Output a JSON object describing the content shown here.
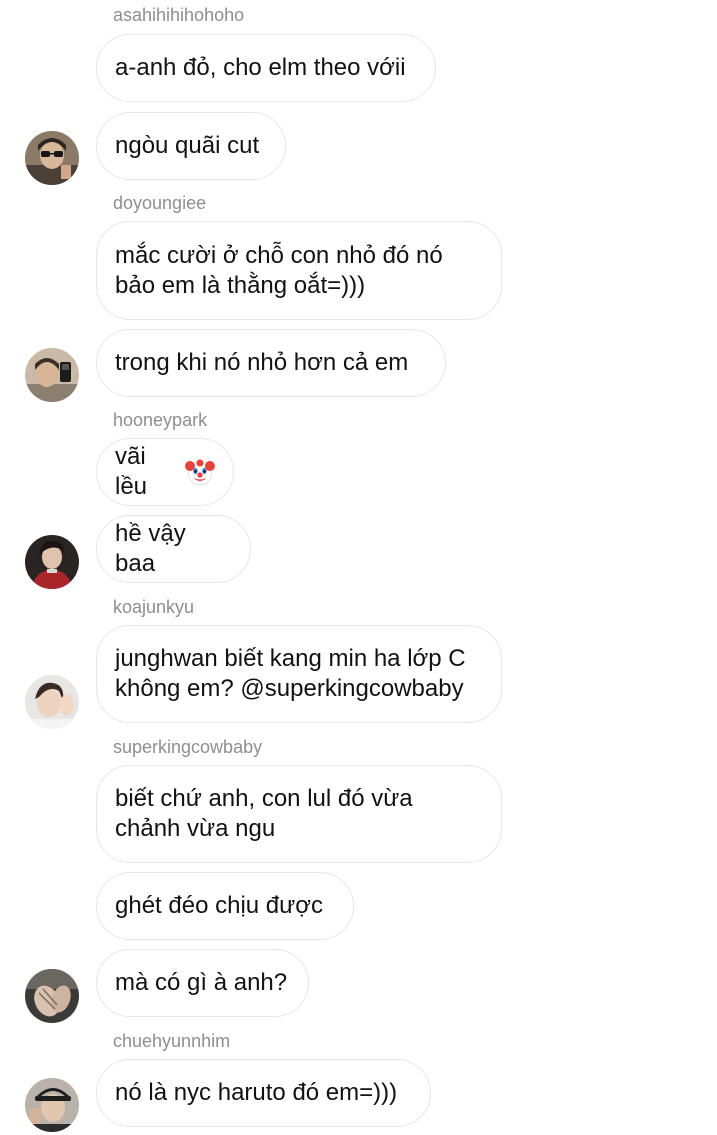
{
  "messages": [
    {
      "username": "asahihihihohoho",
      "text": "a-anh đỏ, cho elm theo vớii"
    },
    {
      "text": "ngòu quãi cut",
      "avatar": "user-avatar-sunglasses"
    },
    {
      "username": "doyoungiee",
      "text": "mắc cười ở chỗ con nhỏ đó nó\nbảo em là thằng oắt=)))"
    },
    {
      "text": "trong khi nó nhỏ hơn cả em",
      "avatar": "user-avatar-mirror-selfie"
    },
    {
      "username": "hooneypark",
      "text": "vãi lều",
      "emoji": "clown-face-emoji"
    },
    {
      "text": "hề vậy baa",
      "avatar": "user-avatar-red-jacket"
    },
    {
      "username": "koajunkyu",
      "text": "junghwan biết kang min ha lớp C\nkhông em? @superkingcowbaby",
      "avatar": "user-avatar-hand-pose"
    },
    {
      "username": "superkingcowbaby",
      "text": "biết chứ anh, con lul đó vừa\nchảnh vừa ngu"
    },
    {
      "text": "ghét đéo chịu được"
    },
    {
      "text": "mà có gì à anh?",
      "avatar": "user-avatar-hands"
    },
    {
      "username": "chuehyunnhim",
      "text": "nó là nyc haruto đó em=)))",
      "avatar": "user-avatar-cap-selfie"
    }
  ]
}
